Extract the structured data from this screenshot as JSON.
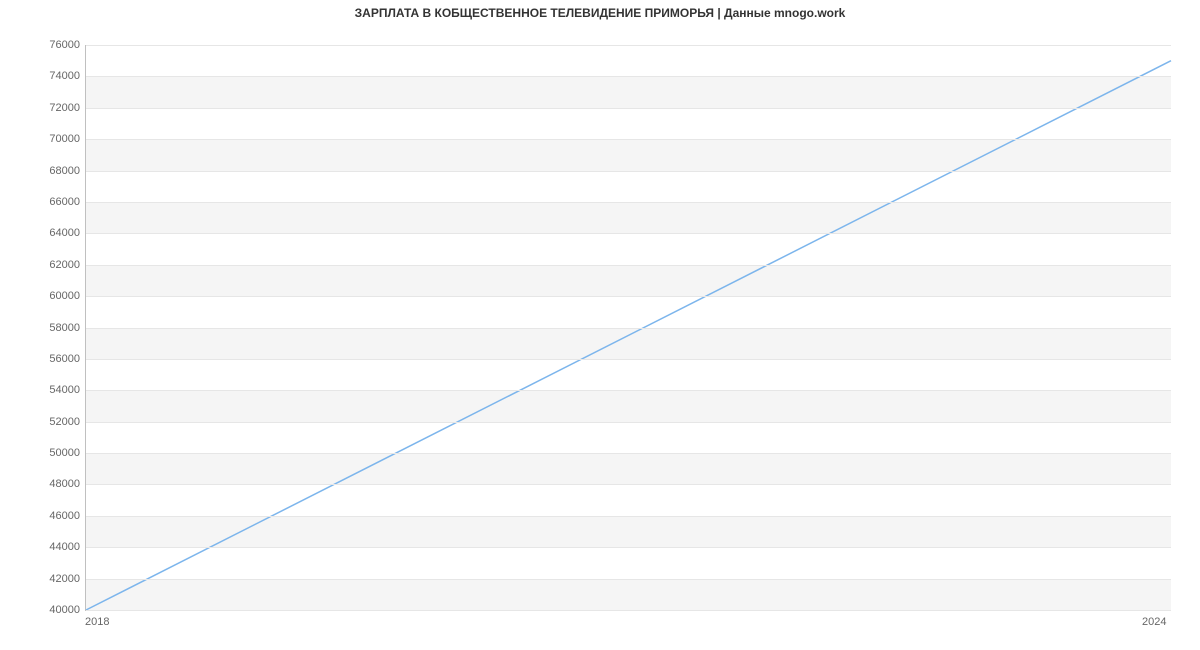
{
  "chart_data": {
    "type": "line",
    "title": "ЗАРПЛАТА В КОБЩЕСТВЕННОЕ ТЕЛЕВИДЕНИЕ ПРИМОРЬЯ | Данные mnogo.work",
    "xlabel": "",
    "ylabel": "",
    "x": [
      2018,
      2024
    ],
    "values": [
      40000,
      75000
    ],
    "xlim": [
      2018,
      2024
    ],
    "ylim": [
      40000,
      76000
    ],
    "yticks": [
      40000,
      42000,
      44000,
      46000,
      48000,
      50000,
      52000,
      54000,
      56000,
      58000,
      60000,
      62000,
      64000,
      66000,
      68000,
      70000,
      72000,
      74000,
      76000
    ],
    "xticks": [
      2018,
      2024
    ],
    "line_color": "#7cb5ec",
    "band_color": "#f5f5f5"
  }
}
